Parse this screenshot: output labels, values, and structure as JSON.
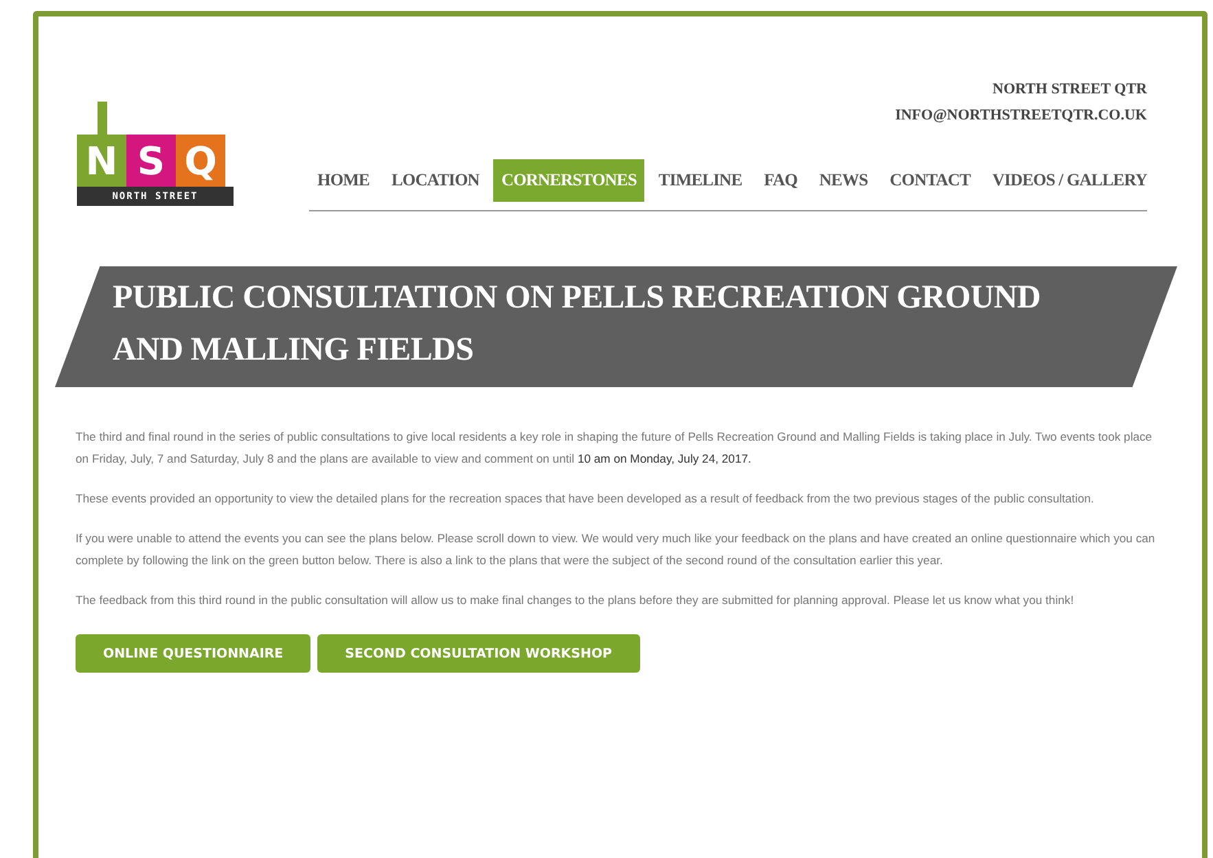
{
  "logo": {
    "letters": [
      {
        "text": "N",
        "color": "#7fa531"
      },
      {
        "text": "S",
        "color": "#d4177f"
      },
      {
        "text": "Q",
        "color": "#e5731d"
      }
    ],
    "tagline": "NORTH STREET"
  },
  "contact": {
    "name": "NORTH STREET QTR",
    "email": "INFO@NORTHSTREETQTR.CO.UK"
  },
  "nav": [
    {
      "label": "HOME",
      "selected": false
    },
    {
      "label": "LOCATION",
      "selected": false
    },
    {
      "label": "CORNERSTONES",
      "selected": true
    },
    {
      "label": "TIMELINE",
      "selected": false
    },
    {
      "label": "FAQ",
      "selected": false
    },
    {
      "label": "NEWS",
      "selected": false
    },
    {
      "label": "CONTACT",
      "selected": false
    },
    {
      "label": "VIDEOS / GALLERY",
      "selected": false
    }
  ],
  "banner": {
    "title": "PUBLIC CONSULTATION ON PELLS RECREATION GROUND AND MALLING FIELDS"
  },
  "paragraphs": [
    "The third and final round in the series of public consultations  to give local residents a key role in shaping the future of Pells Recreation Ground and Malling Fields is taking place in July. Two events took place on Friday, July, 7  and Saturday, July 8 and the plans are available to view and comment on until **10 am on Monday, July 24, 2017.**",
    "These events provided an opportunity to view the detailed plans for the recreation spaces that have been developed as a result of feedback from the two previous stages of the public consultation.",
    "If you were unable to attend the events you can see the plans below.  Please scroll down to view.  We would very much like your feedback on the plans and have created an online questionnaire which you can complete by following the link on the green button below.  There is also a link to the plans that were the subject of the second round of the consultation earlier this year.",
    "The feedback from this third round in the public consultation will allow us to make final changes to the plans before they are submitted for planning approval.  Please let us know what you think!"
  ],
  "buttons": [
    "ONLINE QUESTIONNAIRE",
    "SECOND CONSULTATION WORKSHOP"
  ]
}
